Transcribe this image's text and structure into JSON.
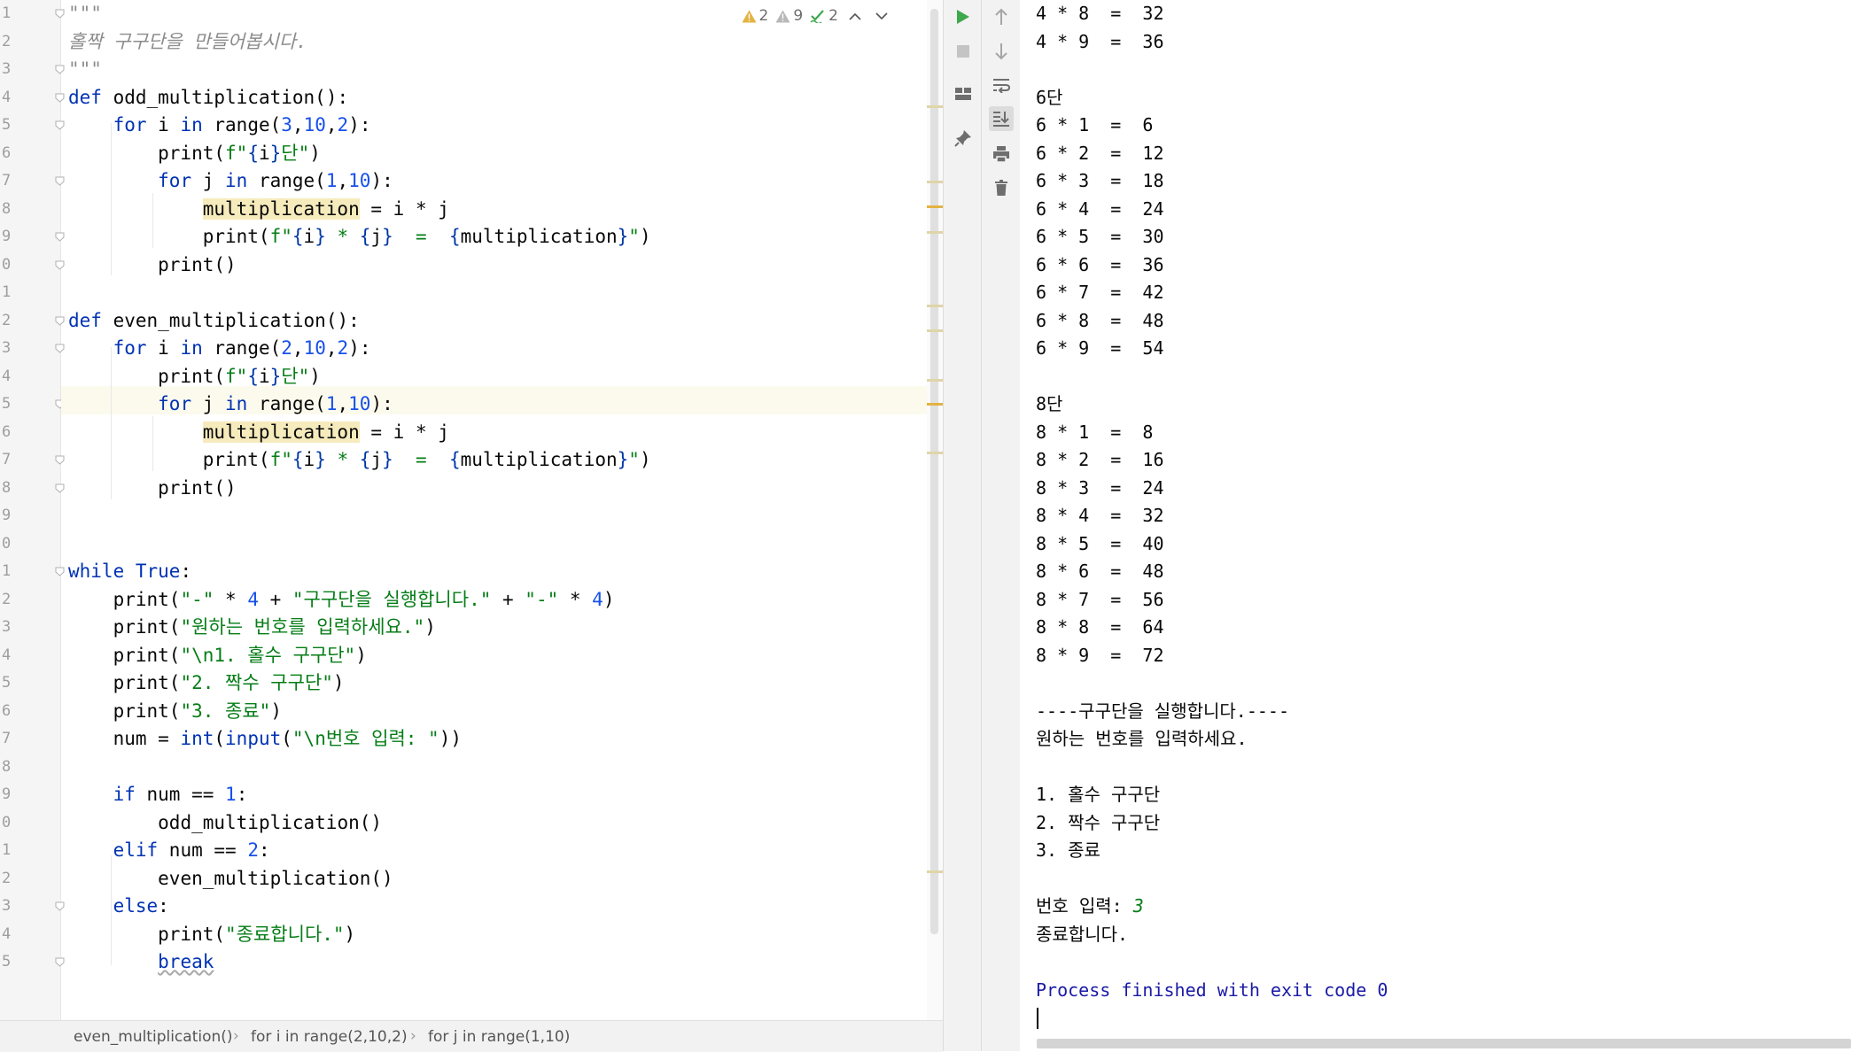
{
  "editor": {
    "inspections": {
      "warnings": "2",
      "weak_warnings": "9",
      "typos": "2"
    },
    "line_numbers": [
      "1",
      "2",
      "3",
      "4",
      "5",
      "6",
      "7",
      "8",
      "9",
      "0",
      "1",
      "2",
      "3",
      "4",
      "5",
      "6",
      "7",
      "8",
      "9",
      "0",
      "1",
      "2",
      "3",
      "4",
      "5",
      "6",
      "7",
      "8",
      "9",
      "0",
      "1",
      "2",
      "3",
      "4",
      "5"
    ],
    "code": {
      "l1": "\"\"\"",
      "l2": "홀짝 구구단을 만들어봅시다.",
      "l3": "\"\"\"",
      "def1_name": "odd_multiplication",
      "def2_name": "even_multiplication",
      "range_odd": [
        "3",
        "10",
        "2"
      ],
      "range_even": [
        "2",
        "10",
        "2"
      ],
      "range_j": [
        "1",
        "10"
      ],
      "dan_suffix": "단",
      "multiplication_var": "multiplication",
      "while_header": "True",
      "print_dashes": "\"-\"",
      "print_4": "4",
      "print_run_msg": "\"구구단을 실행합니다.\"",
      "print_want": "\"원하는 번호를 입력하세요.\"",
      "print_opt1_prefix": "\"\\n1. ",
      "print_opt1_text": "홀수 구구단\"",
      "print_opt2_prefix": "\"2. ",
      "print_opt2_text": "짝수 구구단\"",
      "print_opt3_prefix": "\"3. ",
      "print_opt3_text": "종료\"",
      "input_prompt_prefix": "\"\\n",
      "input_prompt_text": "번호 입력: \"",
      "if_val": "1",
      "elif_val": "2",
      "end_msg": "\"종료합니다.\"",
      "break_kw": "break"
    }
  },
  "breadcrumb": [
    "even_multiplication()",
    "for i in range(2,10,2)",
    "for j in range(1,10)"
  ],
  "console": {
    "lines": [
      "4 * 8  =  32",
      "4 * 9  =  36",
      "",
      "6단",
      "6 * 1  =  6",
      "6 * 2  =  12",
      "6 * 3  =  18",
      "6 * 4  =  24",
      "6 * 5  =  30",
      "6 * 6  =  36",
      "6 * 7  =  42",
      "6 * 8  =  48",
      "6 * 9  =  54",
      "",
      "8단",
      "8 * 1  =  8",
      "8 * 2  =  16",
      "8 * 3  =  24",
      "8 * 4  =  32",
      "8 * 5  =  40",
      "8 * 6  =  48",
      "8 * 7  =  56",
      "8 * 8  =  64",
      "8 * 9  =  72",
      "",
      "----구구단을 실행합니다.----",
      "원하는 번호를 입력하세요.",
      "",
      "1. 홀수 구구단",
      "2. 짝수 구구단",
      "3. 종료",
      "",
      "번호 입력: ",
      "종료합니다.",
      "",
      "Process finished with exit code 0"
    ],
    "user_input": "3"
  },
  "colors": {
    "keyword": "#0033b3",
    "number": "#1750eb",
    "string": "#067d17",
    "comment": "#8c8c8c",
    "run_green": "#3ea84d",
    "warning": "#e3b341"
  }
}
